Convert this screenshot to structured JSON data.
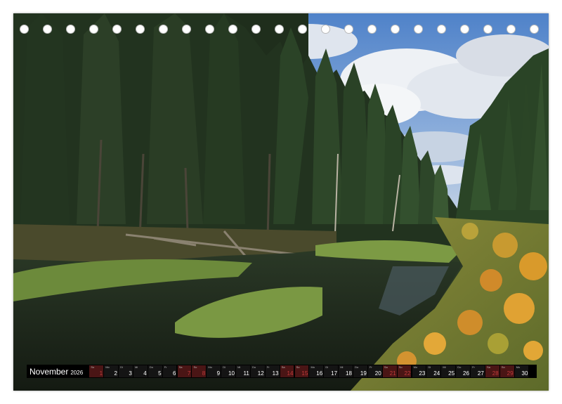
{
  "calendar": {
    "month": "November",
    "year": "2026",
    "days": [
      {
        "wd": "So",
        "n": "1",
        "sun": true
      },
      {
        "wd": "Mo",
        "n": "2",
        "sun": false
      },
      {
        "wd": "Di",
        "n": "3",
        "sun": false
      },
      {
        "wd": "Mi",
        "n": "4",
        "sun": false
      },
      {
        "wd": "Do",
        "n": "5",
        "sun": false
      },
      {
        "wd": "Fr",
        "n": "6",
        "sun": false
      },
      {
        "wd": "Sa",
        "n": "7",
        "sun": true
      },
      {
        "wd": "So",
        "n": "8",
        "sun": true
      },
      {
        "wd": "Mo",
        "n": "9",
        "sun": false
      },
      {
        "wd": "Di",
        "n": "10",
        "sun": false
      },
      {
        "wd": "Mi",
        "n": "11",
        "sun": false
      },
      {
        "wd": "Do",
        "n": "12",
        "sun": false
      },
      {
        "wd": "Fr",
        "n": "13",
        "sun": false
      },
      {
        "wd": "Sa",
        "n": "14",
        "sun": true
      },
      {
        "wd": "So",
        "n": "15",
        "sun": true
      },
      {
        "wd": "Mo",
        "n": "16",
        "sun": false
      },
      {
        "wd": "Di",
        "n": "17",
        "sun": false
      },
      {
        "wd": "Mi",
        "n": "18",
        "sun": false
      },
      {
        "wd": "Do",
        "n": "19",
        "sun": false
      },
      {
        "wd": "Fr",
        "n": "20",
        "sun": false
      },
      {
        "wd": "Sa",
        "n": "21",
        "sun": true
      },
      {
        "wd": "So",
        "n": "22",
        "sun": true
      },
      {
        "wd": "Mo",
        "n": "23",
        "sun": false
      },
      {
        "wd": "Di",
        "n": "24",
        "sun": false
      },
      {
        "wd": "Mi",
        "n": "25",
        "sun": false
      },
      {
        "wd": "Do",
        "n": "26",
        "sun": false
      },
      {
        "wd": "Fr",
        "n": "27",
        "sun": false
      },
      {
        "wd": "Sa",
        "n": "28",
        "sun": true
      },
      {
        "wd": "So",
        "n": "29",
        "sun": true
      },
      {
        "wd": "Mo",
        "n": "30",
        "sun": false
      }
    ]
  },
  "colors": {
    "sky": "#5f8fd0",
    "cloud": "#eef1f5",
    "forest_dark": "#1e2d1c",
    "forest_mid": "#2f4a2a",
    "grass": "#6f8a3a",
    "water": "#1b2418",
    "autumn_leaves": "#d99a2b",
    "sunday_number": "#c43a3a"
  }
}
